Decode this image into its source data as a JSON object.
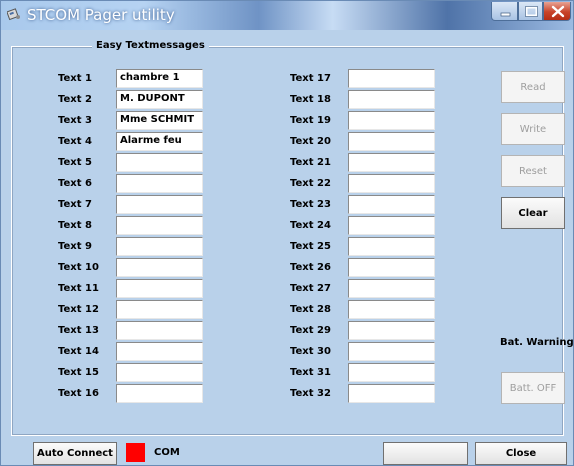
{
  "window": {
    "title": "STCOM Pager utility"
  },
  "group": {
    "title": "Easy Textmessages"
  },
  "texts_left": [
    {
      "label": "Text 1",
      "value": "chambre 1"
    },
    {
      "label": "Text 2",
      "value": "M. DUPONT"
    },
    {
      "label": "Text 3",
      "value": "Mme SCHMIT"
    },
    {
      "label": "Text 4",
      "value": "Alarme feu"
    },
    {
      "label": "Text 5",
      "value": ""
    },
    {
      "label": "Text 6",
      "value": ""
    },
    {
      "label": "Text 7",
      "value": ""
    },
    {
      "label": "Text 8",
      "value": ""
    },
    {
      "label": "Text 9",
      "value": ""
    },
    {
      "label": "Text 10",
      "value": ""
    },
    {
      "label": "Text 11",
      "value": ""
    },
    {
      "label": "Text 12",
      "value": ""
    },
    {
      "label": "Text 13",
      "value": ""
    },
    {
      "label": "Text 14",
      "value": ""
    },
    {
      "label": "Text 15",
      "value": ""
    },
    {
      "label": "Text 16",
      "value": ""
    }
  ],
  "texts_right": [
    {
      "label": "Text 17",
      "value": ""
    },
    {
      "label": "Text 18",
      "value": ""
    },
    {
      "label": "Text 19",
      "value": ""
    },
    {
      "label": "Text 20",
      "value": ""
    },
    {
      "label": "Text 21",
      "value": ""
    },
    {
      "label": "Text 22",
      "value": ""
    },
    {
      "label": "Text 23",
      "value": ""
    },
    {
      "label": "Text 24",
      "value": ""
    },
    {
      "label": "Text 25",
      "value": ""
    },
    {
      "label": "Text 26",
      "value": ""
    },
    {
      "label": "Text 27",
      "value": ""
    },
    {
      "label": "Text 28",
      "value": ""
    },
    {
      "label": "Text 29",
      "value": ""
    },
    {
      "label": "Text 30",
      "value": ""
    },
    {
      "label": "Text 31",
      "value": ""
    },
    {
      "label": "Text 32",
      "value": ""
    }
  ],
  "buttons": {
    "read": "Read",
    "write": "Write",
    "reset": "Reset",
    "clear": "Clear",
    "batt_off": "Batt. OFF",
    "auto_connect": "Auto Connect",
    "blank": "",
    "close": "Close"
  },
  "status": {
    "bat_warning": "Bat. Warning",
    "com_label": "COM",
    "com_indicator_color": "#ff0000"
  },
  "icons": {
    "app": "pager-app-icon",
    "minimize": "minimize-icon",
    "maximize": "maximize-icon",
    "close": "close-icon"
  },
  "colors": {
    "window_background": "#b9d1ea",
    "close_button": "#c8442a"
  }
}
